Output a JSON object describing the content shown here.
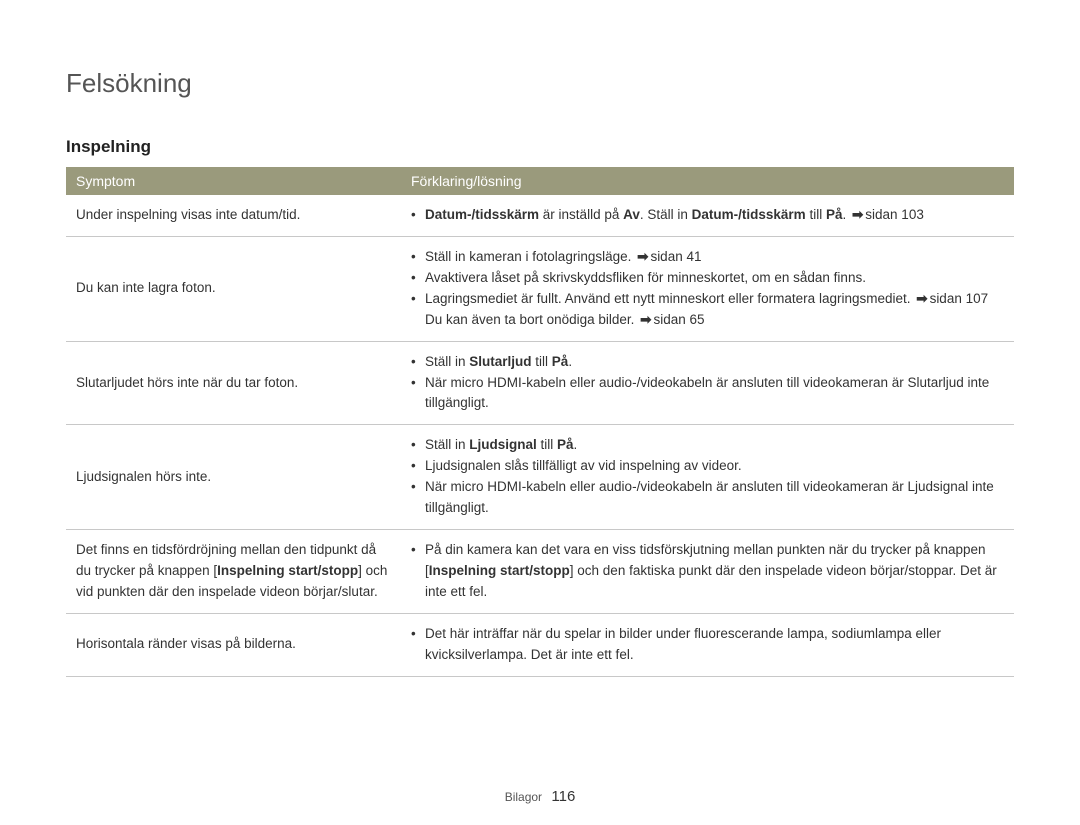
{
  "page_title": "Felsökning",
  "section_title": "Inspelning",
  "headers": {
    "col1": "Symptom",
    "col2": "Förklaring/lösning"
  },
  "rows": [
    {
      "symptom": "Under inspelning visas inte datum/tid.",
      "bullets": [
        {
          "pre": "",
          "b1": "Datum-/tidsskärm",
          "mid1": " är inställd på ",
          "b2": "Av",
          "mid2": ". Ställ in ",
          "b3": "Datum-/tidsskärm",
          "mid3": " till ",
          "b4": "På",
          "tail": ". ",
          "arrow": "➡",
          "ref": "sidan 103"
        }
      ]
    },
    {
      "symptom": "Du kan inte lagra foton.",
      "bullets": [
        {
          "text": "Ställ in kameran i fotolagringsläge. ",
          "arrow": "➡",
          "ref": "sidan 41"
        },
        {
          "text": "Avaktivera låset på skrivskyddsfliken för minneskortet, om en sådan finns."
        },
        {
          "text": "Lagringsmediet är fullt. Använd ett nytt minneskort eller formatera lagringsmediet. ",
          "arrow": "➡",
          "ref": "sidan 107 Du kan även ta bort onödiga bilder. ",
          "arrow2": "➡",
          "ref2": "sidan 65"
        }
      ]
    },
    {
      "symptom": "Slutarljudet hörs inte när du tar foton.",
      "bullets": [
        {
          "pre": "Ställ in ",
          "b1": "Slutarljud",
          "mid1": " till ",
          "b2": "På",
          "tail": "."
        },
        {
          "text": "När micro HDMI-kabeln eller audio-/videokabeln är ansluten till videokameran är Slutarljud inte tillgängligt."
        }
      ]
    },
    {
      "symptom": "Ljudsignalen hörs inte.",
      "bullets": [
        {
          "pre": "Ställ in ",
          "b1": "Ljudsignal",
          "mid1": " till ",
          "b2": "På",
          "tail": "."
        },
        {
          "text": "Ljudsignalen slås tillfälligt av vid inspelning av videor."
        },
        {
          "text": "När micro HDMI-kabeln eller audio-/videokabeln är ansluten till videokameran är Ljudsignal inte tillgängligt."
        }
      ]
    },
    {
      "symptom_pre": "Det finns en tidsfördröjning mellan den tidpunkt då du trycker på knappen [",
      "symptom_bold": "Inspelning start/stopp",
      "symptom_post": "] och vid punkten där den inspelade videon börjar/slutar.",
      "bullets": [
        {
          "pre": "På din kamera kan det vara en viss tidsförskjutning mellan punkten när du trycker på knappen [",
          "b1": "Inspelning start/stopp",
          "tail": "] och den faktiska punkt där den inspelade videon börjar/stoppar. Det är inte ett fel."
        }
      ]
    },
    {
      "symptom": "Horisontala ränder visas på bilderna.",
      "bullets": [
        {
          "text": "Det här inträffar när du spelar in bilder under fluorescerande lampa, sodiumlampa eller kvicksilverlampa. Det är inte ett fel."
        }
      ]
    }
  ],
  "footer": {
    "label": "Bilagor",
    "page": "116"
  }
}
